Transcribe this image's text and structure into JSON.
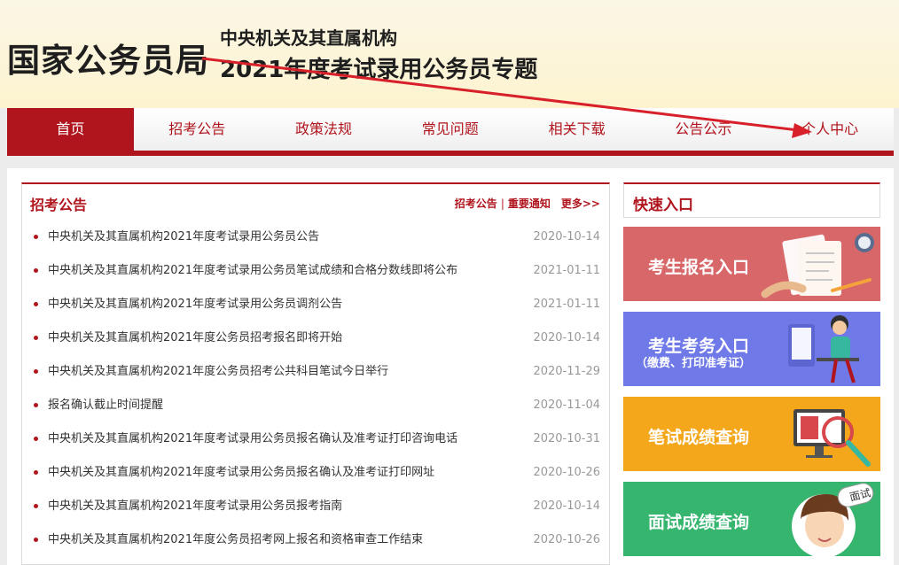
{
  "header": {
    "site_title": "国家公务员局",
    "sub_title_1": "中央机关及其直属机构",
    "sub_title_2": "2021年度考试录用公务员专题"
  },
  "nav": {
    "items": [
      "首页",
      "招考公告",
      "政策法规",
      "常见问题",
      "相关下载",
      "公告公示",
      "个人中心"
    ],
    "active_index": 0
  },
  "news": {
    "title": "招考公告",
    "link_1": "招考公告",
    "separator": "|",
    "link_2": "重要通知",
    "more": "更多>>",
    "items": [
      {
        "text": "中央机关及其直属机构2021年度考试录用公务员公告",
        "date": "2020-10-14"
      },
      {
        "text": "中央机关及其直属机构2021年度考试录用公务员笔试成绩和合格分数线即将公布",
        "date": "2021-01-11"
      },
      {
        "text": "中央机关及其直属机构2021年度考试录用公务员调剂公告",
        "date": "2021-01-11"
      },
      {
        "text": "中央机关及其直属机构2021年度公务员招考报名即将开始",
        "date": "2020-10-14"
      },
      {
        "text": "中央机关及其直属机构2021年度公务员招考公共科目笔试今日举行",
        "date": "2020-11-29"
      },
      {
        "text": "报名确认截止时间提醒",
        "date": "2020-11-04"
      },
      {
        "text": "中央机关及其直属机构2021年度考试录用公务员报名确认及准考证打印咨询电话",
        "date": "2020-10-31"
      },
      {
        "text": "中央机关及其直属机构2021年度考试录用公务员报名确认及准考证打印网址",
        "date": "2020-10-26"
      },
      {
        "text": "中央机关及其直属机构2021年度考试录用公务员报考指南",
        "date": "2020-10-14"
      },
      {
        "text": "中央机关及其直属机构2021年度公务员招考网上报名和资格审查工作结束",
        "date": "2020-10-26"
      }
    ]
  },
  "quick": {
    "title": "快速入口",
    "entries": [
      {
        "label": "考生报名入口",
        "color": "#d8676a"
      },
      {
        "label": "考生考务入口",
        "sublabel": "（缴费、打印准考证）",
        "color": "#6f79e8"
      },
      {
        "label": "笔试成绩查询",
        "color": "#f5a71c"
      },
      {
        "label": "面试成绩查询",
        "badge": "面试",
        "color": "#35b56e"
      }
    ]
  },
  "colors": {
    "brand_red": "#b0151d",
    "annotation_arrow": "#d8202a"
  }
}
